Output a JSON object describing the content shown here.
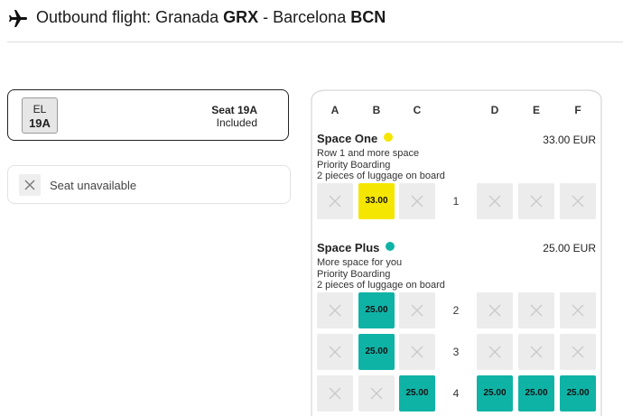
{
  "header": {
    "prefix": "Outbound flight: Granada ",
    "origin_code": "GRX",
    "separator": " - Barcelona ",
    "dest_code": "BCN"
  },
  "passenger": {
    "initials": "EL",
    "seat": "19A",
    "seat_label": "Seat 19A",
    "price_label": "Included"
  },
  "legend": {
    "unavailable_label": "Seat unavailable"
  },
  "columns": [
    "A",
    "B",
    "C",
    "D",
    "E",
    "F"
  ],
  "zones": [
    {
      "title": "Space One",
      "color": "#f5e600",
      "price": "33.00 EUR",
      "desc": [
        "Row 1 and more space",
        "Priority Boarding",
        "2 pieces of luggage on board"
      ]
    },
    {
      "title": "Space Plus",
      "color": "#0fb3a6",
      "price": "25.00 EUR",
      "desc": [
        "More space for you",
        "Priority Boarding",
        "2 pieces of luggage on board"
      ]
    }
  ],
  "rows": [
    {
      "num": "1",
      "seats": [
        {
          "status": "unavailable"
        },
        {
          "status": "available",
          "price": "33.00",
          "zone": "one"
        },
        {
          "status": "unavailable"
        },
        {
          "status": "unavailable"
        },
        {
          "status": "unavailable"
        },
        {
          "status": "unavailable"
        }
      ]
    },
    {
      "num": "2",
      "seats": [
        {
          "status": "unavailable"
        },
        {
          "status": "available",
          "price": "25.00",
          "zone": "plus"
        },
        {
          "status": "unavailable"
        },
        {
          "status": "unavailable"
        },
        {
          "status": "unavailable"
        },
        {
          "status": "unavailable"
        }
      ]
    },
    {
      "num": "3",
      "seats": [
        {
          "status": "unavailable"
        },
        {
          "status": "available",
          "price": "25.00",
          "zone": "plus"
        },
        {
          "status": "unavailable"
        },
        {
          "status": "unavailable"
        },
        {
          "status": "unavailable"
        },
        {
          "status": "unavailable"
        }
      ]
    },
    {
      "num": "4",
      "seats": [
        {
          "status": "unavailable"
        },
        {
          "status": "unavailable"
        },
        {
          "status": "available",
          "price": "25.00",
          "zone": "plus"
        },
        {
          "status": "available",
          "price": "25.00",
          "zone": "plus"
        },
        {
          "status": "available",
          "price": "25.00",
          "zone": "plus"
        },
        {
          "status": "available",
          "price": "25.00",
          "zone": "plus"
        }
      ]
    }
  ],
  "icons": {
    "header": "airplane-icon",
    "unavailable": "x-icon"
  }
}
